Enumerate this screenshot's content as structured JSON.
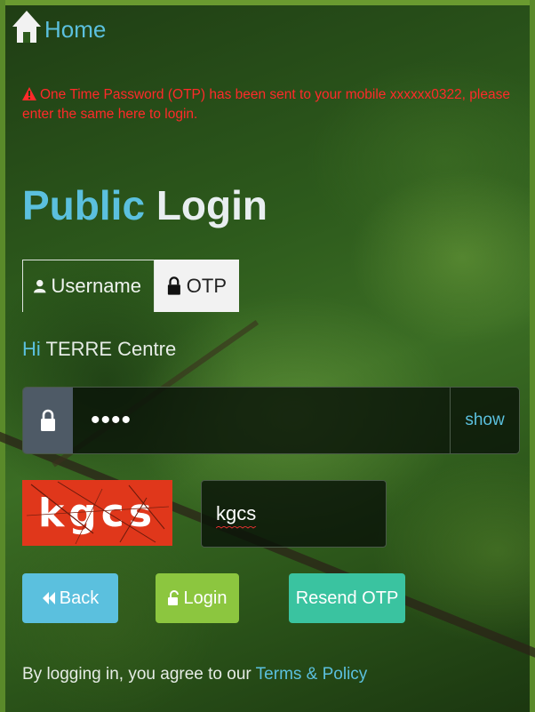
{
  "nav": {
    "home_label": "Home"
  },
  "alert": {
    "message": "One Time Password (OTP) has been sent to your mobile xxxxxx0322, please enter the same here to login."
  },
  "title": {
    "strong": "Public",
    "light": "Login"
  },
  "tabs": [
    {
      "label": "Username",
      "icon": "user-icon"
    },
    {
      "label": "OTP",
      "icon": "lock-icon",
      "active": true
    }
  ],
  "greeting": {
    "hi": "Hi",
    "name": "TERRE Centre"
  },
  "otp_field": {
    "value": "••••",
    "toggle_label": "show"
  },
  "captcha": {
    "image_text": "kgcs",
    "input_value": "kgcs"
  },
  "buttons": {
    "back": "Back",
    "login": "Login",
    "resend": "Resend OTP"
  },
  "footer": {
    "agree_text": "By logging in, you agree to our",
    "terms_link": "Terms & Policy"
  },
  "colors": {
    "accent": "#5bc0de",
    "error": "#ff2a2a",
    "login_green": "#8cc63f",
    "resend_teal": "#3ac3a0",
    "captcha_red": "#e0371b"
  }
}
